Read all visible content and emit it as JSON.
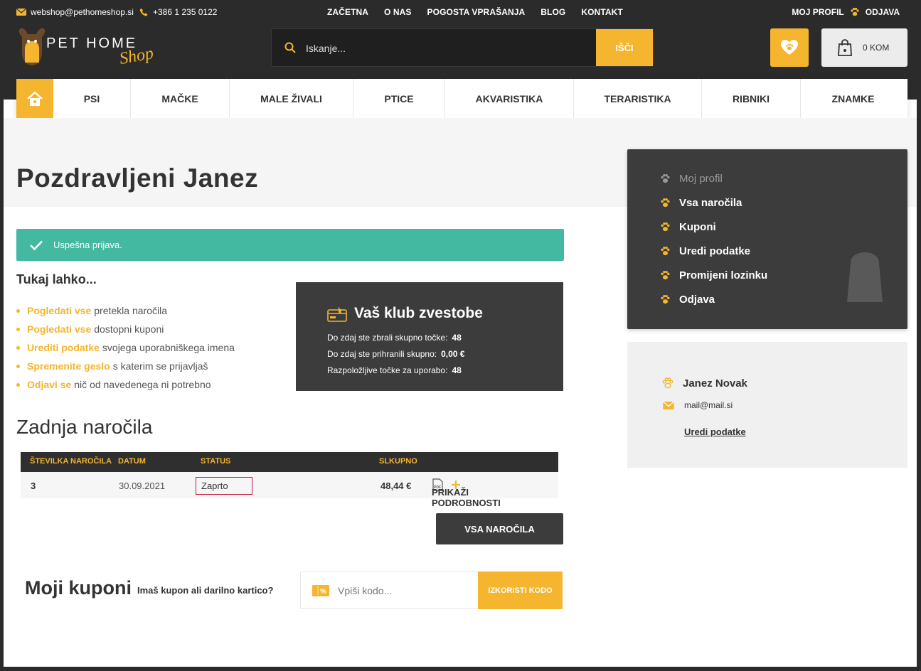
{
  "topbar": {
    "email": "webshop@pethomeshop.si",
    "phone": "+386 1 235 0122",
    "nav": [
      "ZAČETNA",
      "O NAS",
      "POGOSTA VPRAŠANJA",
      "BLOG",
      "KONTAKT"
    ],
    "profile_label": "MOJ PROFIL",
    "logout_label": "ODJAVA"
  },
  "logo": {
    "brand": "PET HOME",
    "script": "Shop"
  },
  "search": {
    "placeholder": "Iskanje...",
    "button": "IŠČI"
  },
  "cart": {
    "label": "0 KOM"
  },
  "categories": [
    "PSI",
    "MAČKE",
    "MALE ŽIVALI",
    "PTICE",
    "AKVARISTIKA",
    "TERARISTIKA",
    "RIBNIKI",
    "ZNAMKE"
  ],
  "page": {
    "greeting": "Pozdravljeni Janez"
  },
  "alert": {
    "message": "Uspešna prijava."
  },
  "intro": {
    "title": "Tukaj lahko...",
    "items": [
      {
        "link": "Pogledati vse",
        "text": "pretekla naročila"
      },
      {
        "link": "Pogledati vse",
        "text": "dostopni kuponi"
      },
      {
        "link": "Urediti podatke",
        "text": "svojega uporabniškega imena"
      },
      {
        "link": "Spremenite geslo",
        "text": "s katerim se prijavljaš"
      },
      {
        "link": "Odjavi se",
        "text": "nič od navedenega ni potrebno"
      }
    ]
  },
  "club": {
    "title": "Vaš klub zvestobe",
    "rows": [
      {
        "label": "Do zdaj ste zbrali skupno točke:",
        "value": "48"
      },
      {
        "label": "Do zdaj ste prihranili skupno:",
        "value": "0,00 €"
      },
      {
        "label": "Razpoložljive točke za uporabo:",
        "value": "48"
      }
    ]
  },
  "orders": {
    "title": "Zadnja naročila",
    "headers": [
      "ŠTEVILKA NAROČILA",
      "DATUM",
      "STATUS",
      "SLKUPNO"
    ],
    "rows": [
      {
        "number": "3",
        "date": "30.09.2021",
        "status": "Zaprto",
        "total": "48,44 €",
        "details": "PRIKAŽI PODROBNOSTI"
      }
    ],
    "all_button": "VSA NAROČILA"
  },
  "coupons": {
    "title": "Moji kuponi",
    "subtitle": "Imaš kupon ali darilno kartico?",
    "placeholder": "Vpiši kodo...",
    "button": "IZKORISTI KODO"
  },
  "sidebar": {
    "items": [
      "Moj profil",
      "Vsa naročila",
      "Kuponi",
      "Uredi podatke",
      "Promijeni lozinku",
      "Odjava"
    ]
  },
  "user": {
    "name": "Janez Novak",
    "email": "mail@mail.si",
    "edit_link": "Uredi podatke"
  },
  "colors": {
    "accent": "#f5b52e",
    "dark": "#2b2b2b",
    "panel": "#3c3c3c",
    "success": "#43b9a2",
    "status_border": "#c0173a"
  }
}
